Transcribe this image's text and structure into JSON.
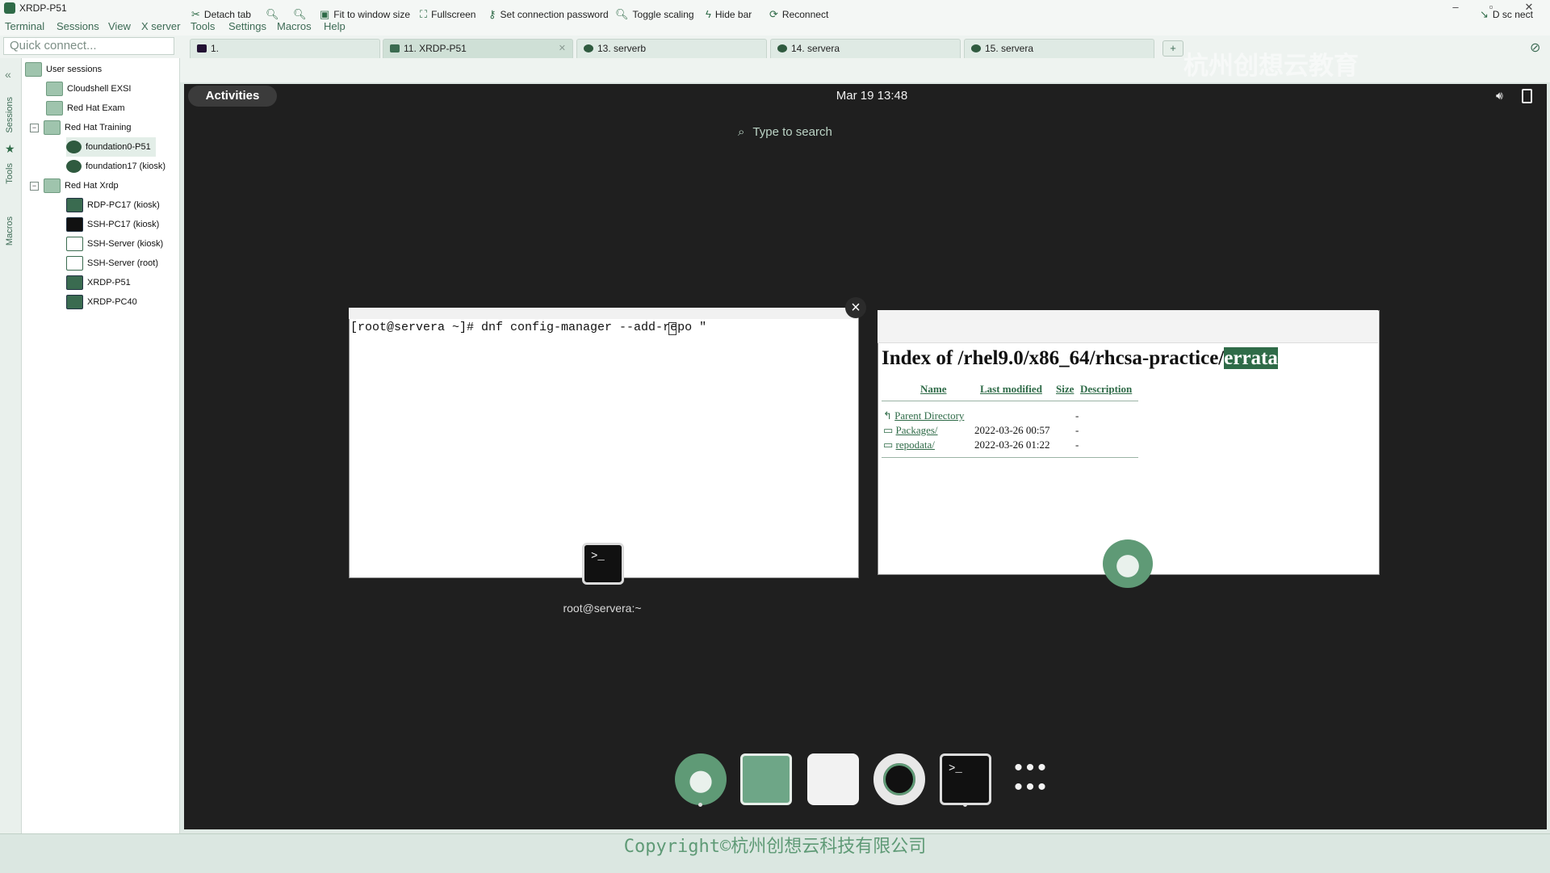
{
  "window": {
    "title": "XRDP-P51"
  },
  "menu": [
    "Terminal",
    "Sessions",
    "View",
    "X server",
    "Tools",
    "Settings",
    "Macros",
    "Help"
  ],
  "quick_connect": {
    "placeholder": "Quick connect..."
  },
  "tabs": [
    {
      "label": "1.",
      "active": false
    },
    {
      "label": "11. XRDP-P51",
      "active": true
    },
    {
      "label": "13. serverb",
      "active": false
    },
    {
      "label": "14. servera",
      "active": false
    },
    {
      "label": "15. servera",
      "active": false
    }
  ],
  "side_tabs": [
    "Sessions",
    "Tools",
    "Macros"
  ],
  "sessions": {
    "root": "User sessions",
    "items": [
      {
        "label": "Cloudshell EXSI",
        "level": 1,
        "icon": "folder-icon"
      },
      {
        "label": "Red Hat Exam",
        "level": 1,
        "icon": "folder-icon"
      },
      {
        "label": "Red Hat Training",
        "level": 1,
        "icon": "folder-icon",
        "expanded": true
      },
      {
        "label": "foundation0-P51",
        "level": 2,
        "icon": "server-icon",
        "selected": true
      },
      {
        "label": "foundation17 (kiosk)",
        "level": 2,
        "icon": "server-icon"
      },
      {
        "label": "Red Hat Xrdp",
        "level": 1,
        "icon": "folder-icon",
        "expanded": true
      },
      {
        "label": "RDP-PC17 (kiosk)",
        "level": 2,
        "icon": "monitor-icon"
      },
      {
        "label": "SSH-PC17 (kiosk)",
        "level": 2,
        "icon": "monitor-icon"
      },
      {
        "label": "SSH-Server (kiosk)",
        "level": 2,
        "icon": "house-icon"
      },
      {
        "label": "SSH-Server (root)",
        "level": 2,
        "icon": "house-icon"
      },
      {
        "label": "XRDP-P51",
        "level": 2,
        "icon": "monitor-icon"
      },
      {
        "label": "XRDP-PC40",
        "level": 2,
        "icon": "monitor-icon"
      }
    ]
  },
  "toolbar": {
    "detach": "Detach tab",
    "fit": "Fit to window size",
    "fullscreen": "Fullscreen",
    "password": "Set connection password",
    "scaling": "Toggle scaling",
    "hidebar": "Hide bar",
    "reconnect": "Reconnect",
    "disconnect": "D sc nect"
  },
  "gnome": {
    "activities": "Activities",
    "clock": "Mar 19  13:48",
    "search_placeholder": "Type to search"
  },
  "terminal": {
    "command": "[root@servera ~]# dnf config-manager --add-repo \"",
    "label": "root@servera:~"
  },
  "browser": {
    "title_prefix": "Index of /rhel9.0/x86_64/rhcsa-practice/",
    "title_highlight": "errata",
    "headers": [
      "Name",
      "Last modified",
      "Size",
      "Description"
    ],
    "rows": [
      {
        "name": "Parent Directory",
        "modified": "",
        "size": "-"
      },
      {
        "name": "Packages/",
        "modified": "2022-03-26 00:57",
        "size": "-"
      },
      {
        "name": "repodata/",
        "modified": "2022-03-26 01:22",
        "size": "-"
      }
    ]
  },
  "watermark": "杭州创想云教育",
  "footer": {
    "copyright": "Copyright©杭州创想云科技有限公司"
  },
  "colors": {
    "accent": "#2f6b48",
    "desktop_bg": "#1f1f1f",
    "panel_bg": "#eef3f0"
  }
}
